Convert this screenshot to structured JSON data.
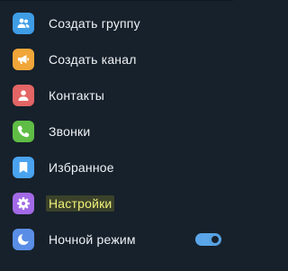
{
  "menu": {
    "items": [
      {
        "label": "Создать группу",
        "icon": "group-icon",
        "color": "#3f9de6"
      },
      {
        "label": "Создать канал",
        "icon": "megaphone-icon",
        "color": "#f1a63a"
      },
      {
        "label": "Контакты",
        "icon": "contact-icon",
        "color": "#e36565"
      },
      {
        "label": "Звонки",
        "icon": "phone-icon",
        "color": "#5fbd45"
      },
      {
        "label": "Избранное",
        "icon": "bookmark-icon",
        "color": "#4aa3ef"
      },
      {
        "label": "Настройки",
        "icon": "gear-icon",
        "color": "#a36ae7",
        "highlighted": true
      },
      {
        "label": "Ночной режим",
        "icon": "moon-icon",
        "color": "#5a8ee6",
        "toggle": true
      }
    ]
  },
  "night_mode": {
    "enabled": true
  },
  "colors": {
    "background": "#17212b",
    "text": "#eef2f6",
    "highlight_text": "#f1f07a",
    "toggle_active": "#5aa6e8"
  }
}
